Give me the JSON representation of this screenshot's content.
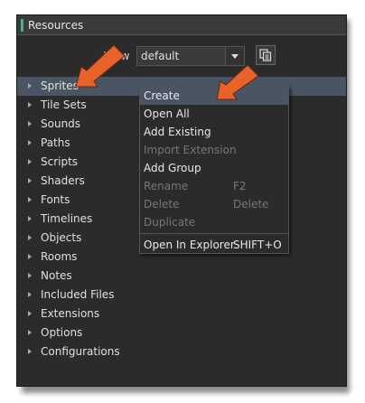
{
  "window": {
    "title": "Resources"
  },
  "view": {
    "label": "View",
    "selected": "default"
  },
  "tree": {
    "items": [
      {
        "label": "Sprites"
      },
      {
        "label": "Tile Sets"
      },
      {
        "label": "Sounds"
      },
      {
        "label": "Paths"
      },
      {
        "label": "Scripts"
      },
      {
        "label": "Shaders"
      },
      {
        "label": "Fonts"
      },
      {
        "label": "Timelines"
      },
      {
        "label": "Objects"
      },
      {
        "label": "Rooms"
      },
      {
        "label": "Notes"
      },
      {
        "label": "Included Files"
      },
      {
        "label": "Extensions"
      },
      {
        "label": "Options"
      },
      {
        "label": "Configurations"
      }
    ]
  },
  "context_menu": {
    "items": [
      {
        "label": "Create",
        "shortcut": ""
      },
      {
        "label": "Open All",
        "shortcut": ""
      },
      {
        "label": "Add Existing",
        "shortcut": ""
      },
      {
        "label": "Import Extension",
        "shortcut": ""
      },
      {
        "label": "Add Group",
        "shortcut": ""
      },
      {
        "label": "Rename",
        "shortcut": "F2"
      },
      {
        "label": "Delete",
        "shortcut": "Delete"
      },
      {
        "label": "Duplicate",
        "shortcut": ""
      },
      {
        "label": "Open In Explorer",
        "shortcut": "SHIFT+O"
      }
    ]
  },
  "colors": {
    "accent": "#4caf7d",
    "selection": "#4a5463",
    "annotation_arrow": "#e8622a"
  },
  "icons": {
    "copy": "copy-icon",
    "dropdown": "chevron-down-icon",
    "expand": "triangle-right-icon"
  }
}
